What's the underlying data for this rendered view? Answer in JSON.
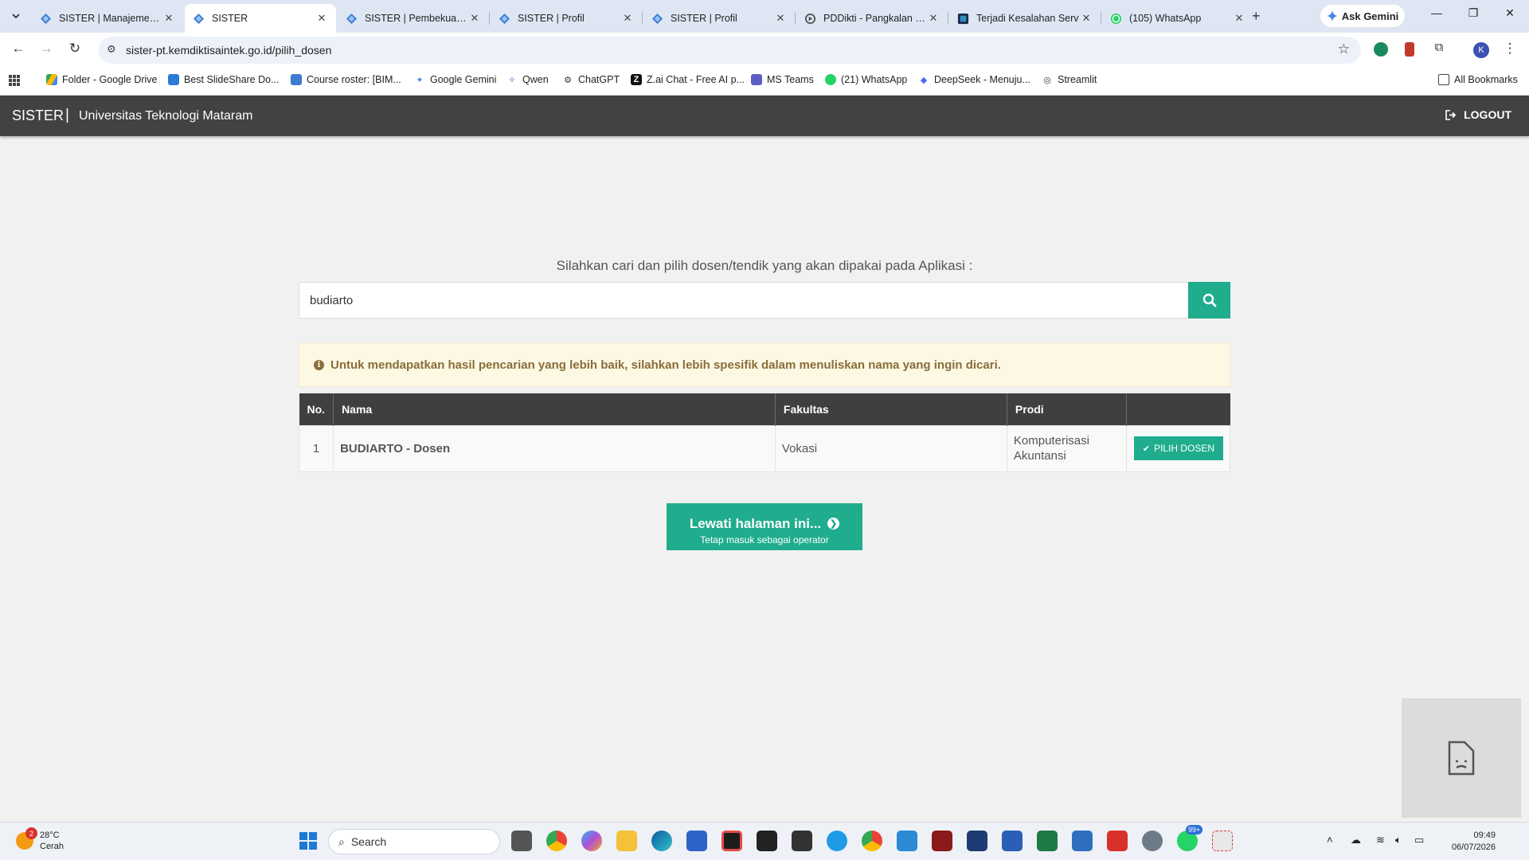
{
  "browser": {
    "tabs": [
      {
        "title": "SISTER | Manajemen_d",
        "active": false
      },
      {
        "title": "SISTER",
        "active": true
      },
      {
        "title": "SISTER | Pembekuan_a",
        "active": false
      },
      {
        "title": "SISTER | Profil",
        "active": false
      },
      {
        "title": "SISTER | Profil",
        "active": false
      },
      {
        "title": "PDDikti - Pangkalan Da",
        "active": false
      },
      {
        "title": "Terjadi Kesalahan Serv",
        "active": false
      },
      {
        "title": "(105) WhatsApp",
        "active": false
      }
    ],
    "ask_gemini": "Ask Gemini",
    "url": "sister-pt.kemdiktisaintek.go.id/pilih_dosen",
    "bookmarks": [
      "Folder - Google Drive",
      "Best SlideShare Do...",
      "Course roster: [BIM...",
      "Google Gemini",
      "Qwen",
      "ChatGPT",
      "Z.ai Chat - Free AI p...",
      "MS Teams",
      "(21) WhatsApp",
      "DeepSeek - Menuju...",
      "Streamlit"
    ],
    "all_bookmarks": "All Bookmarks"
  },
  "header": {
    "brand": "SISTER",
    "separator": "|",
    "institution": "Universitas Teknologi Mataram",
    "logout": "LOGOUT"
  },
  "search": {
    "prompt": "Silahkan cari dan pilih dosen/tendik yang akan dipakai pada Aplikasi :",
    "value": "budiarto"
  },
  "alert": {
    "text": "Untuk mendapatkan hasil pencarian yang lebih baik, silahkan lebih spesifik dalam menuliskan nama yang ingin dicari."
  },
  "table": {
    "headers": [
      "No.",
      "Nama",
      "Fakultas",
      "Prodi",
      ""
    ],
    "rows": [
      {
        "no": "1",
        "nama": "BUDIARTO - Dosen",
        "fakultas": "Vokasi",
        "prodi": "Komputerisasi Akuntansi",
        "action": "PILIH DOSEN"
      }
    ]
  },
  "skip": {
    "label": "Lewati halaman ini...",
    "sub": "Tetap masuk sebagai operator"
  },
  "taskbar": {
    "temperature": "28°C",
    "condition": "Cerah",
    "weather_badge": "2",
    "search": "Search",
    "whatsapp_badge": "99+",
    "time": "09:49",
    "date": "06/07/2026"
  },
  "colors": {
    "accent": "#1fad8d",
    "header_bg": "#424242",
    "alert_bg": "#fcf8e3",
    "alert_text": "#8a6d3b"
  }
}
